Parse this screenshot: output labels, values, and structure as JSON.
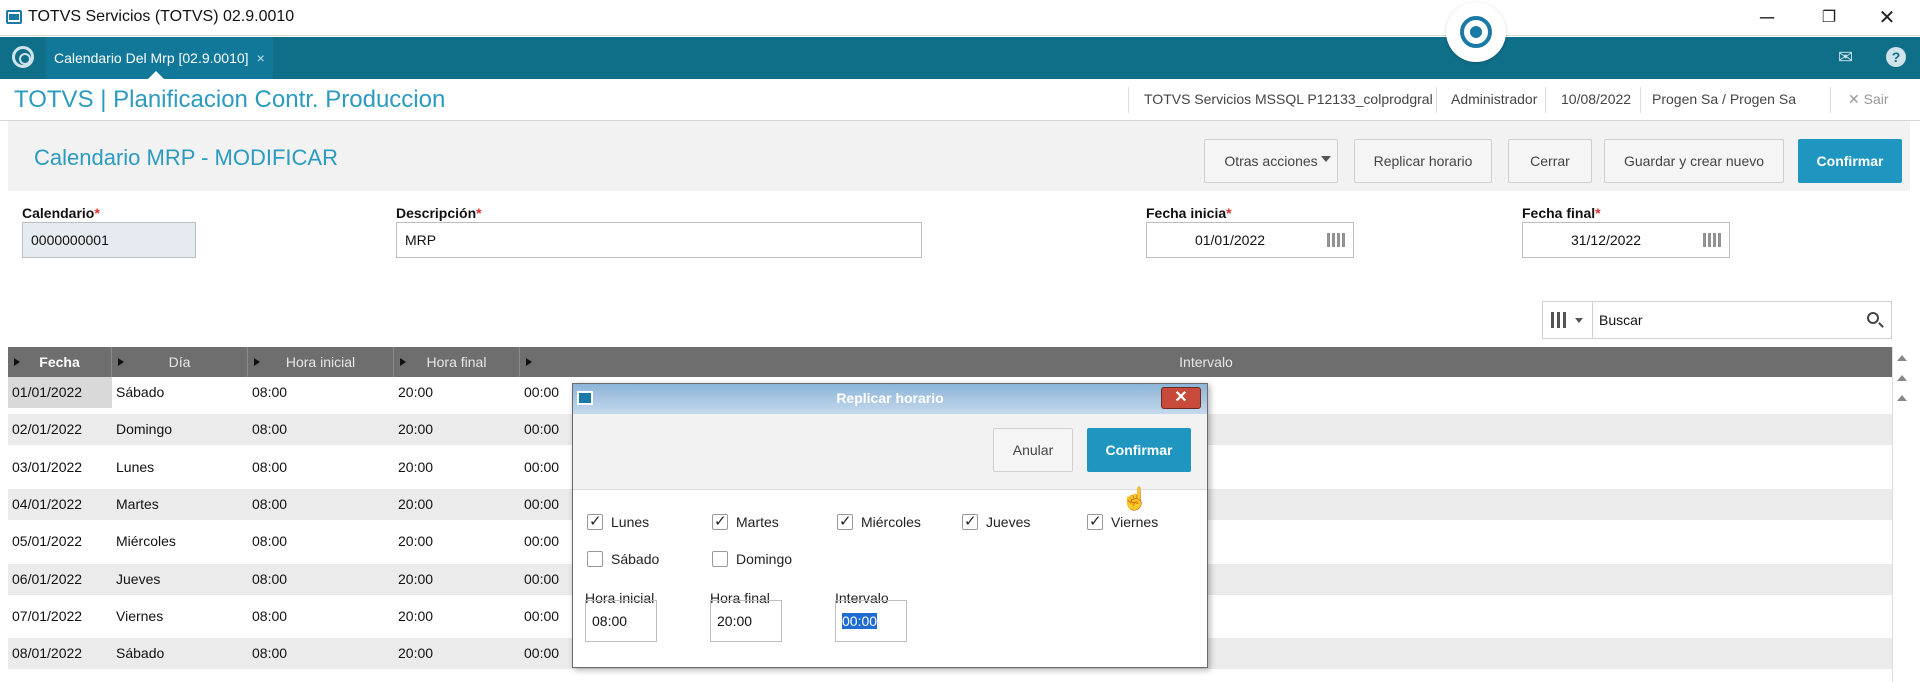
{
  "window": {
    "title": "TOTVS Servicios (TOTVS) 02.9.0010",
    "controls": [
      "─",
      "❐",
      "✕"
    ]
  },
  "tabbar": {
    "tab_label": "Calendario Del Mrp [02.9.0010]",
    "tab_close": "×",
    "mail_icon": "✉",
    "help_icon": "?"
  },
  "appbar": {
    "title": "TOTVS | Planificacion Contr. Produccion",
    "environment": "TOTVS Servicios MSSQL P12133_colprodgral",
    "user": "Administrador",
    "date": "10/08/2022",
    "company": "Progen Sa / Progen Sa",
    "exit_label": "Sair",
    "exit_icon": "✕"
  },
  "page": {
    "title": "Calendario MRP - MODIFICAR",
    "buttons": {
      "other_actions": "Otras acciones",
      "replicate": "Replicar horario",
      "close": "Cerrar",
      "save_new": "Guardar y crear nuevo",
      "confirm": "Confirmar"
    }
  },
  "form": {
    "calendar": {
      "label": "Calendario",
      "value": "0000000001"
    },
    "description": {
      "label": "Descripción",
      "value": "MRP"
    },
    "start_date": {
      "label": "Fecha inicia",
      "value": "01/01/2022"
    },
    "end_date": {
      "label": "Fecha final",
      "value": "31/12/2022"
    },
    "required_mark": "*"
  },
  "search": {
    "value": "Buscar"
  },
  "grid": {
    "headers": [
      "Fecha",
      "Día",
      "Hora inicial",
      "Hora final",
      "Intervalo"
    ],
    "rows": [
      {
        "fecha": "01/01/2022",
        "dia": "Sábado",
        "ini": "08:00",
        "fin": "20:00",
        "int": "00:00"
      },
      {
        "fecha": "02/01/2022",
        "dia": "Domingo",
        "ini": "08:00",
        "fin": "20:00",
        "int": "00:00"
      },
      {
        "fecha": "03/01/2022",
        "dia": "Lunes",
        "ini": "08:00",
        "fin": "20:00",
        "int": "00:00"
      },
      {
        "fecha": "04/01/2022",
        "dia": "Martes",
        "ini": "08:00",
        "fin": "20:00",
        "int": "00:00"
      },
      {
        "fecha": "05/01/2022",
        "dia": "Miércoles",
        "ini": "08:00",
        "fin": "20:00",
        "int": "00:00"
      },
      {
        "fecha": "06/01/2022",
        "dia": "Jueves",
        "ini": "08:00",
        "fin": "20:00",
        "int": "00:00"
      },
      {
        "fecha": "07/01/2022",
        "dia": "Viernes",
        "ini": "08:00",
        "fin": "20:00",
        "int": "00:00"
      },
      {
        "fecha": "08/01/2022",
        "dia": "Sábado",
        "ini": "08:00",
        "fin": "20:00",
        "int": "00:00"
      }
    ]
  },
  "dialog": {
    "title": "Replicar horario",
    "close_icon": "✕",
    "cancel": "Anular",
    "confirm": "Confirmar",
    "days": [
      {
        "label": "Lunes",
        "checked": true
      },
      {
        "label": "Martes",
        "checked": true
      },
      {
        "label": "Miércoles",
        "checked": true
      },
      {
        "label": "Jueves",
        "checked": true
      },
      {
        "label": "Viernes",
        "checked": true
      },
      {
        "label": "Sábado",
        "checked": false
      },
      {
        "label": "Domingo",
        "checked": false
      }
    ],
    "start": {
      "label": "Hora inicial",
      "value": "08:00"
    },
    "end": {
      "label": "Hora final",
      "value": "20:00"
    },
    "interval": {
      "label": "Intervalo",
      "value": "00:00"
    }
  },
  "colors": {
    "accent": "#2b9bc0",
    "tabbar": "#0f6f89",
    "primary_button": "#1f96c0",
    "grid_header": "#6e6e6e"
  }
}
